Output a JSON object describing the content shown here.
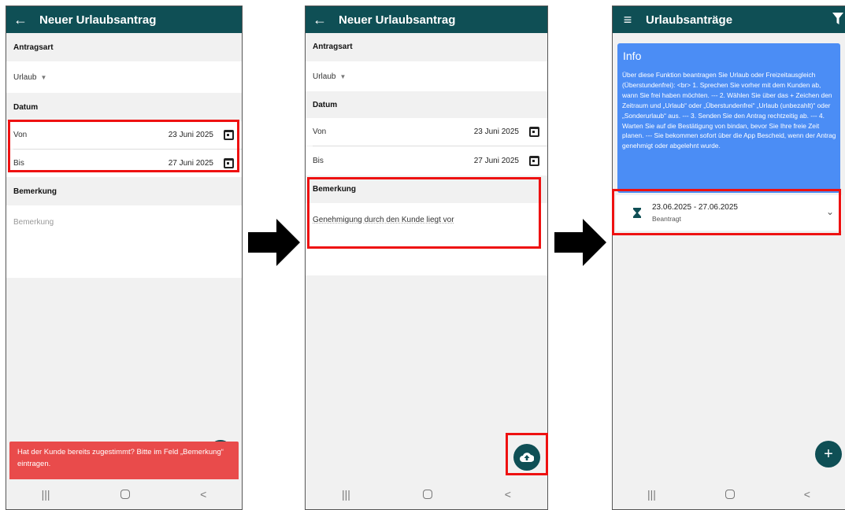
{
  "colors": {
    "appbar": "#0f4f55",
    "highlight": "#e11111",
    "snackbar": "#e94b4b",
    "info": "#4b8df5"
  },
  "screen1": {
    "title": "Neuer Urlaubsantrag",
    "section_type": "Antragsart",
    "type_value": "Urlaub",
    "section_date": "Datum",
    "from_label": "Von",
    "from_value": "23 Juni 2025",
    "to_label": "Bis",
    "to_value": "27 Juni 2025",
    "section_remark": "Bemerkung",
    "remark_placeholder": "Bemerkung",
    "snackbar": "Hat der Kunde bereits zugestimmt? Bitte im Feld „Bemerkung“ eintragen."
  },
  "screen2": {
    "title": "Neuer Urlaubsantrag",
    "section_type": "Antragsart",
    "type_value": "Urlaub",
    "section_date": "Datum",
    "from_label": "Von",
    "from_value": "23 Juni 2025",
    "to_label": "Bis",
    "to_value": "27 Juni 2025",
    "section_remark": "Bemerkung",
    "remark_value": "Genehmigung durch den Kunde liegt vor"
  },
  "screen3": {
    "title": "Urlaubsanträge",
    "info_title": "Info",
    "info_text": "Über diese Funktion beantragen Sie Urlaub oder Freizeitausgleich (Überstundenfrei): <br> 1. Sprechen Sie vorher mit dem Kunden ab, wann Sie frei haben möchten. --- 2. Wählen Sie über das + Zeichen den Zeitraum und „Urlaub“ oder „Überstundenfrei“ „Urlaub (unbezahlt)“ oder „Sonderurlaub“ aus. --- 3. Senden Sie den Antrag rechtzeitig ab. --- 4. Warten Sie auf die Bestätigung von bindan, bevor Sie Ihre freie Zeit planen. --- Sie bekommen sofort über die App Bescheid, wenn der Antrag genehmigt oder abgelehnt wurde.",
    "request_range": "23.06.2025 - 27.06.2025",
    "request_status": "Beantragt"
  },
  "icons": {
    "back": "arrow-left-icon",
    "menu": "hamburger-icon",
    "filter": "filter-icon",
    "calendar": "calendar-icon",
    "upload": "cloud-upload-icon",
    "add": "plus-icon",
    "hourglass": "hourglass-icon",
    "expand": "chevron-down-icon"
  }
}
